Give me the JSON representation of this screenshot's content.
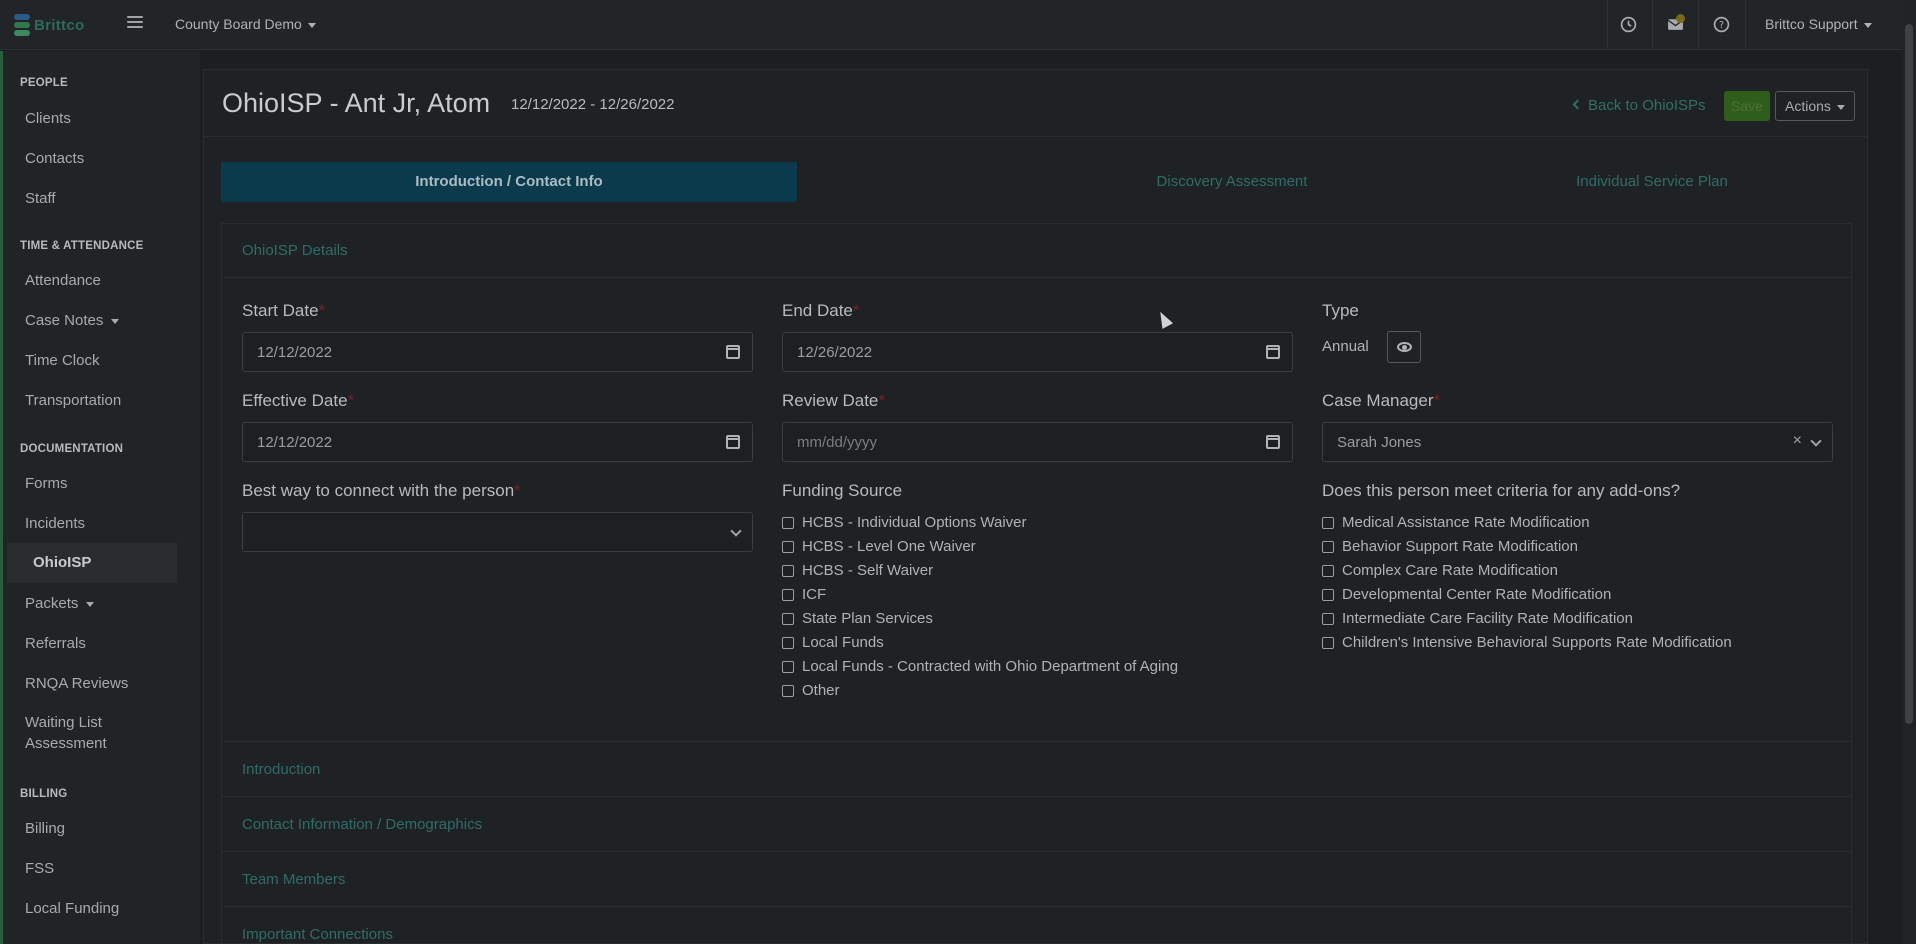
{
  "topbar": {
    "logo_text": "Brittco",
    "org_selector": "County Board Demo",
    "user_menu": "Brittco Support",
    "icons": [
      "history-icon",
      "mail-icon",
      "help-icon"
    ]
  },
  "sidebar": {
    "sections": [
      {
        "title": "PEOPLE",
        "items": [
          "Clients",
          "Contacts",
          "Staff"
        ]
      },
      {
        "title": "TIME & ATTENDANCE",
        "items": [
          "Attendance",
          "Case Notes",
          "Time Clock",
          "Transportation"
        ]
      },
      {
        "title": "DOCUMENTATION",
        "items": [
          "Forms",
          "Incidents",
          "OhioISP",
          "Packets",
          "Referrals",
          "RNQA Reviews",
          "Waiting List",
          "Assessment"
        ]
      },
      {
        "title": "BILLING",
        "items": [
          "Billing",
          "FSS",
          "Local Funding"
        ]
      }
    ],
    "active_item": "OhioISP"
  },
  "header": {
    "title": "OhioISP - Ant Jr, Atom",
    "dates": "12/12/2022 - 12/26/2022",
    "back_link": "Back to OhioISPs",
    "save_label": "Save",
    "actions_label": "Actions"
  },
  "tabs": [
    "Introduction / Contact Info",
    "Discovery Assessment",
    "Individual Service Plan"
  ],
  "details": {
    "heading": "OhioISP Details",
    "start_date": {
      "label": "Start Date",
      "value": "12/12/2022"
    },
    "end_date": {
      "label": "End Date",
      "value": "12/26/2022"
    },
    "type": {
      "label": "Type",
      "value": "Annual"
    },
    "effective_date": {
      "label": "Effective Date",
      "value": "12/12/2022"
    },
    "review_date": {
      "label": "Review Date",
      "placeholder": "mm/dd/yyyy"
    },
    "case_manager": {
      "label": "Case Manager",
      "value": "Sarah Jones"
    },
    "connect": {
      "label": "Best way to connect with the person",
      "value": ""
    },
    "funding": {
      "label": "Funding Source",
      "options": [
        "HCBS - Individual Options Waiver",
        "HCBS - Level One Waiver",
        "HCBS - Self Waiver",
        "ICF",
        "State Plan Services",
        "Local Funds",
        "Local Funds - Contracted with Ohio Department of Aging",
        "Other"
      ]
    },
    "addons": {
      "label": "Does this person meet criteria for any add-ons?",
      "options": [
        "Medical Assistance Rate Modification",
        "Behavior Support Rate Modification",
        "Complex Care Rate Modification",
        "Developmental Center Rate Modification",
        "Intermediate Care Facility Rate Modification",
        "Children's Intensive Behavioral Supports Rate Modification"
      ]
    },
    "required_mark": "*"
  },
  "accordions": [
    "Introduction",
    "Contact Information / Demographics",
    "Team Members",
    "Important Connections"
  ],
  "colors": {
    "active_tab": "#0b3a4c",
    "link": "#2f6c68",
    "save": "#2f5e1c",
    "required": "#7a1f28"
  }
}
